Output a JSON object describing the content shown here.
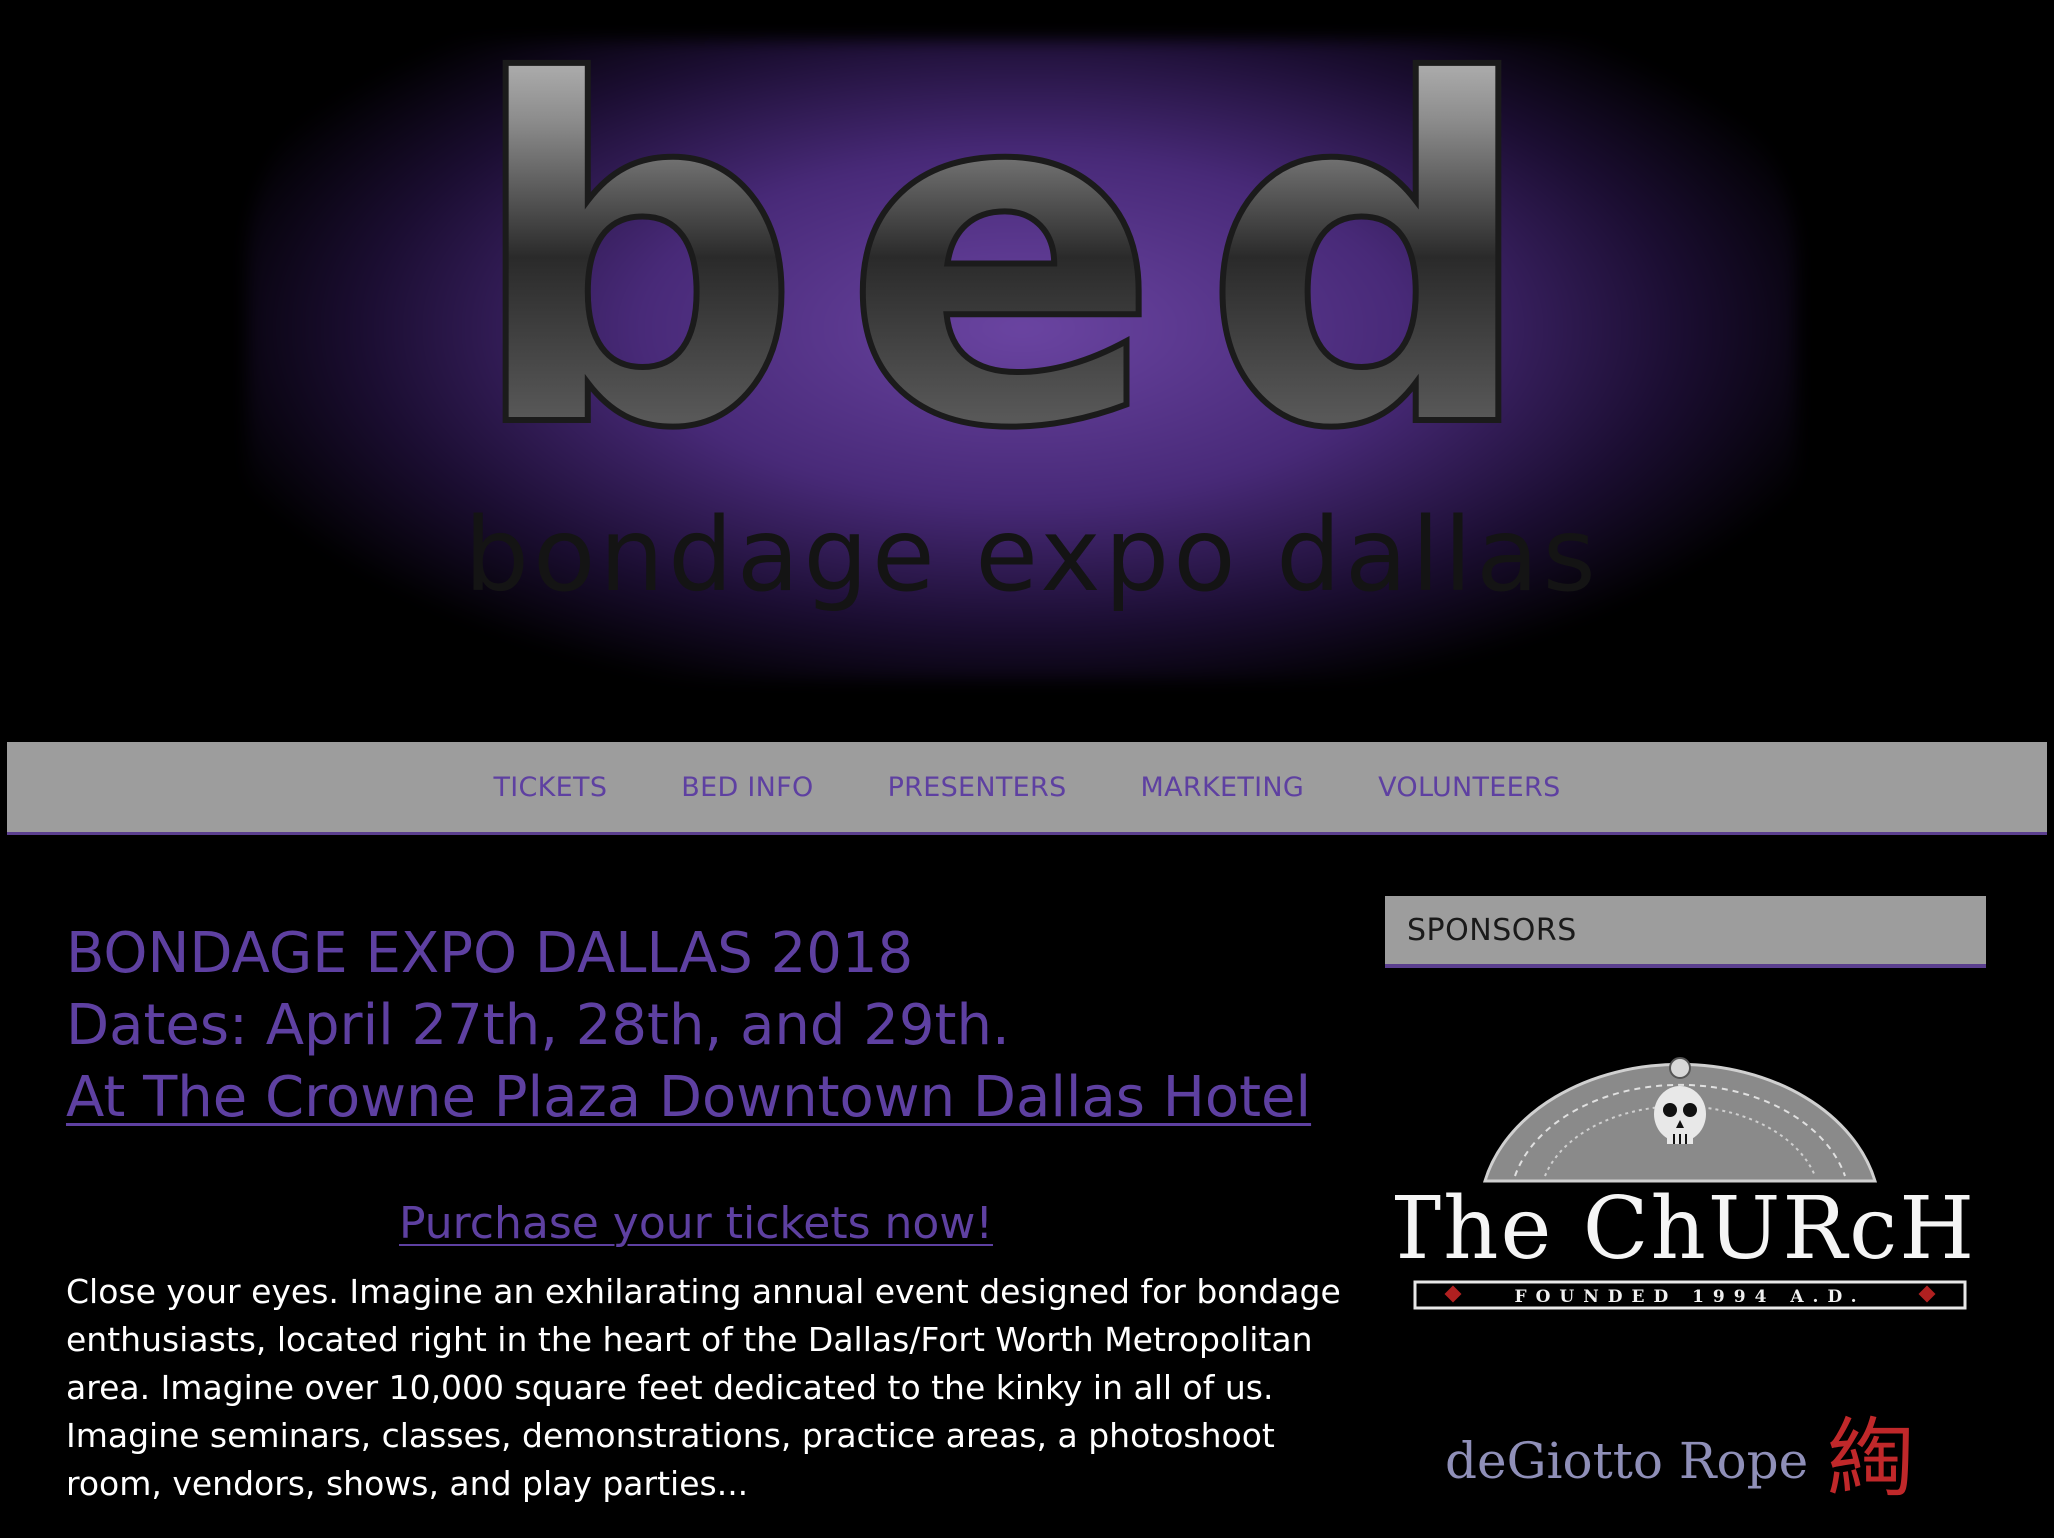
{
  "header": {
    "logo_letters": "bed",
    "logo_subtitle": "bondage expo dallas"
  },
  "nav": {
    "items": [
      {
        "label": "TICKETS"
      },
      {
        "label": "BED INFO"
      },
      {
        "label": "PRESENTERS"
      },
      {
        "label": "MARKETING"
      },
      {
        "label": "VOLUNTEERS"
      }
    ]
  },
  "main": {
    "title": "BONDAGE EXPO DALLAS 2018",
    "dates": "Dates: April 27th, 28th, and 29th.",
    "hotel_link": "At The Crowne Plaza Downtown Dallas Hotel",
    "purchase_link": "Purchase your tickets now!",
    "intro": "Close your eyes. Imagine an exhilarating annual event designed for bondage enthusiasts, located right in the heart of the Dallas/Fort Worth Metropolitan area. Imagine over 10,000 square feet dedicated to the kinky in all of us. Imagine seminars, classes, demonstrations, practice areas, a photoshoot room, vendors, shows, and play parties..."
  },
  "sidebar": {
    "title": "SPONSORS",
    "sponsors": [
      {
        "name": "The ChURcH",
        "tagline": "FOUNDED 1994 A.D."
      },
      {
        "name": "deGiotto Rope",
        "glyph": "綯"
      }
    ]
  },
  "colors": {
    "accent_purple": "#5e40a1",
    "nav_bg": "#9d9d9d",
    "background": "#000000",
    "logo_glow": "#7048aa",
    "degiotto_text": "#8f8fb8",
    "degiotto_glyph": "#c0282a"
  }
}
